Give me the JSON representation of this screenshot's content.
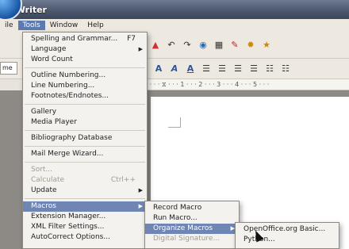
{
  "window": {
    "title": "g Writer"
  },
  "menubar": {
    "items": [
      {
        "label": "ile"
      },
      {
        "label": "Tools"
      },
      {
        "label": "Window"
      },
      {
        "label": "Help"
      }
    ]
  },
  "font_field": {
    "value": "me"
  },
  "ruler": {
    "text": "· 1 · · · ⧖ · · · 1 · · · 2 · · · 3 · · · 4 · · · 5 · · ·"
  },
  "tools_menu": {
    "groups": [
      [
        {
          "label": "Spelling and Grammar...",
          "shortcut": "F7"
        },
        {
          "label": "Language",
          "submenu": true
        },
        {
          "label": "Word Count"
        }
      ],
      [
        {
          "label": "Outline Numbering..."
        },
        {
          "label": "Line Numbering..."
        },
        {
          "label": "Footnotes/Endnotes..."
        }
      ],
      [
        {
          "label": "Gallery"
        },
        {
          "label": "Media Player"
        }
      ],
      [
        {
          "label": "Bibliography Database"
        }
      ],
      [
        {
          "label": "Mail Merge Wizard..."
        }
      ],
      [
        {
          "label": "Sort...",
          "disabled": true
        },
        {
          "label": "Calculate",
          "shortcut": "Ctrl++",
          "disabled": true
        },
        {
          "label": "Update",
          "submenu": true
        }
      ],
      [
        {
          "label": "Macros",
          "submenu": true,
          "highlighted": true
        },
        {
          "label": "Extension Manager..."
        },
        {
          "label": "XML Filter Settings..."
        },
        {
          "label": "AutoCorrect Options..."
        }
      ]
    ]
  },
  "macros_menu": {
    "items": [
      {
        "label": "Record Macro"
      },
      {
        "label": "Run Macro..."
      },
      {
        "label": "Organize Macros",
        "submenu": true,
        "highlighted": true
      },
      {
        "label": "Digital Signature...",
        "disabled": true
      }
    ]
  },
  "organize_menu": {
    "items": [
      {
        "label": "OpenOffice.org Basic..."
      },
      {
        "label": "Python..."
      }
    ]
  },
  "colors": {
    "highlight": "#6f86b5",
    "titlebar": "#4d586e",
    "doc_bg": "#8d8a86"
  }
}
